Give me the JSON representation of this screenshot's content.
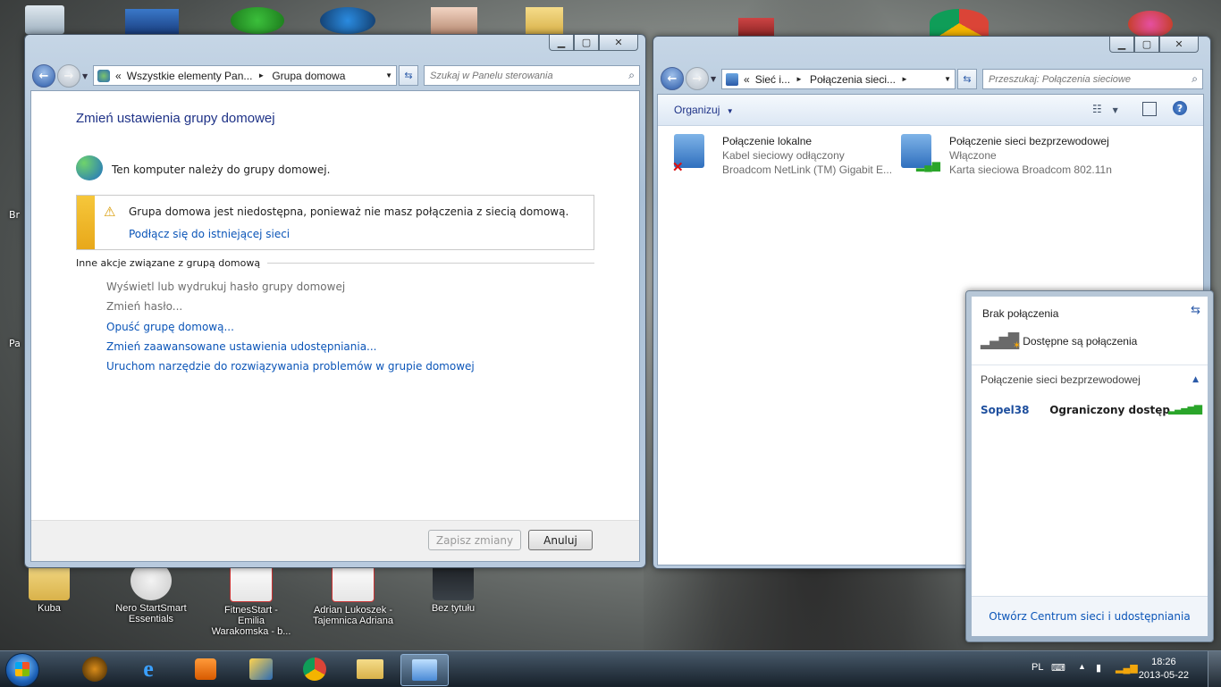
{
  "desktop": {
    "icons": [
      {
        "label": "Kuba"
      },
      {
        "label": "Nero StartSmart Essentials"
      },
      {
        "label": "FitnesStart - Emilia Warakomska - b..."
      },
      {
        "label": "Adrian Lukoszek - Tajemnica Adriana"
      },
      {
        "label": "Bez tytułu"
      }
    ],
    "partial_labels": {
      "br": "Br",
      "pa": "Pa"
    }
  },
  "homegroup_window": {
    "breadcrumb": {
      "prefix": "«",
      "part1": "Wszystkie elementy Pan...",
      "part2": "Grupa domowa"
    },
    "search_placeholder": "Szukaj w Panelu sterowania",
    "title": "Zmień ustawienia grupy domowej",
    "member_text": "Ten komputer należy do grupy domowej.",
    "warning_text": "Grupa domowa jest niedostępna, ponieważ nie masz połączenia z siecią domową.",
    "warning_link": "Podłącz się do istniejącej sieci",
    "section_header": "Inne akcje związane z grupą domową",
    "actions": [
      {
        "label": "Wyświetl lub wydrukuj hasło grupy domowej"
      },
      {
        "label": "Zmień hasło..."
      },
      {
        "label": "Opuść grupę domową..."
      },
      {
        "label": "Zmień zaawansowane ustawienia udostępniania..."
      },
      {
        "label": "Uruchom narzędzie do rozwiązywania problemów w grupie domowej"
      }
    ],
    "save_label": "Zapisz zmiany",
    "cancel_label": "Anuluj"
  },
  "network_window": {
    "breadcrumb": {
      "prefix": "«",
      "part1": "Sieć i...",
      "part2": "Połączenia sieci..."
    },
    "search_placeholder": "Przeszukaj: Połączenia sieciowe",
    "organize_label": "Organizuj",
    "connections": [
      {
        "name": "Połączenie lokalne",
        "status": "Kabel sieciowy odłączony",
        "adapter": "Broadcom NetLink (TM) Gigabit E..."
      },
      {
        "name": "Połączenie sieci bezprzewodowej",
        "status": "Włączone",
        "adapter": "Karta sieciowa Broadcom 802.11n"
      }
    ]
  },
  "network_flyout": {
    "status": "Brak połączenia",
    "available": "Dostępne są połączenia",
    "section": "Połączenie sieci bezprzewodowej",
    "network_name": "Sopel38",
    "network_status": "Ograniczony dostęp",
    "footer_link": "Otwórz Centrum sieci i udostępniania"
  },
  "taskbar": {
    "lang": "PL",
    "time": "18:26",
    "date": "2013-05-22"
  }
}
